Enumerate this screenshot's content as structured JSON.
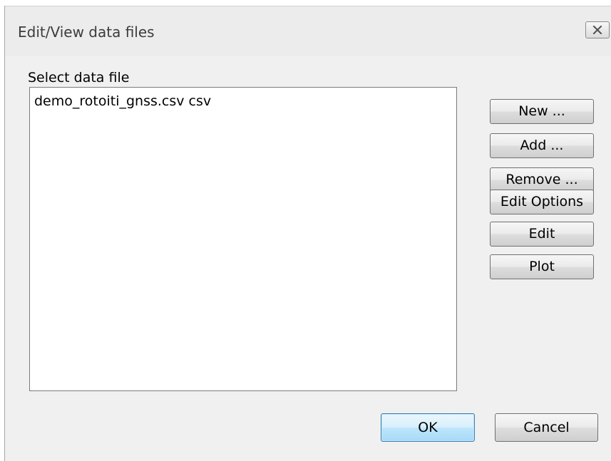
{
  "window": {
    "title": "Edit/View data files",
    "close_icon": "close-x-icon"
  },
  "file_list": {
    "label": "Select data file",
    "items": [
      {
        "text": "demo_rotoiti_gnss.csv csv"
      }
    ]
  },
  "side_buttons": {
    "new_label": "New ...",
    "add_label": "Add ...",
    "remove_label": "Remove ...",
    "edit_options_label": "Edit Options",
    "edit_label": "Edit",
    "plot_label": "Plot"
  },
  "footer": {
    "ok_label": "OK",
    "cancel_label": "Cancel"
  },
  "colors": {
    "dialog_background": "#f0f0f0",
    "default_button_border": "#3c7fb1",
    "default_button_fill": "#bee6fd"
  }
}
